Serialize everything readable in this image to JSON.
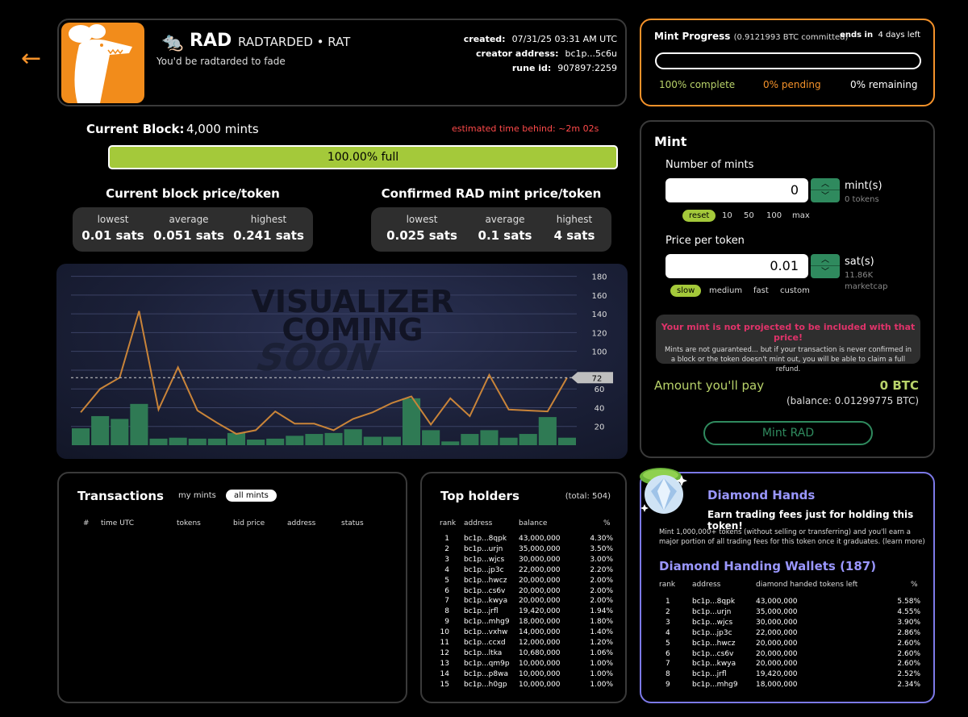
{
  "colors": {
    "accent": "#f5922a",
    "lime": "#a4c93a",
    "green": "#2f8a5e",
    "purple": "#9a97ff",
    "red": "#ff4a4a"
  },
  "icons": {
    "back": "left-arrow-icon",
    "logo": "rat-logo-icon",
    "gem": "diamond-gem-icon"
  },
  "header": {
    "back_arrow": "←",
    "emoji": "🐀",
    "ticker": "RAD",
    "rune_name": "RADTARDED • RAT",
    "tagline": "You'd be radtarded to fade",
    "created_label": "created:",
    "created_value": "07/31/25   03:31 AM UTC",
    "creator_label": "creator address:",
    "creator_value": "bc1p...5c6u",
    "rune_label": "rune id:",
    "rune_value": "907897:2259"
  },
  "block": {
    "label": "Current Block:",
    "value": "4,000 mints",
    "eta": "estimated time behind: ~2m 02s",
    "fill_text": "100.00% full",
    "fill_fraction": 1.0
  },
  "current_price": {
    "title": "Current block price/token",
    "lowest_label": "lowest",
    "lowest_value": "0.01 sats",
    "average_label": "average",
    "average_value": "0.051 sats",
    "highest_label": "highest",
    "highest_value": "0.241 sats"
  },
  "confirmed_price": {
    "title": "Confirmed RAD mint price/token",
    "lowest_label": "lowest",
    "lowest_value": "0.025 sats",
    "average_label": "average",
    "average_value": "0.1 sats",
    "highest_label": "highest",
    "highest_value": "4 sats"
  },
  "chart_data": {
    "type": "bar",
    "overlay_text": [
      "VISUALIZER",
      "COMING",
      "SOON"
    ],
    "y_ticks": [
      20,
      40,
      60,
      80,
      100,
      120,
      140,
      160,
      180
    ],
    "ylim": [
      0,
      185
    ],
    "marker_value": 72,
    "bars": [
      18,
      31,
      28,
      44,
      7,
      8,
      7,
      7,
      13,
      6,
      7,
      10,
      12,
      13,
      17,
      9,
      9,
      50,
      16,
      4,
      12,
      16,
      8,
      12,
      30,
      8
    ],
    "line": [
      35,
      60,
      72,
      143,
      38,
      83,
      37,
      24,
      12,
      16,
      36,
      23,
      23,
      16,
      28,
      35,
      45,
      52,
      22,
      50,
      31,
      75,
      38,
      37,
      36,
      72
    ],
    "colors": {
      "bar": "#2f7a54",
      "line": "#c98439",
      "marker": "#bfbfbf"
    }
  },
  "mint_progress": {
    "title": "Mint Progress",
    "btc_committed": "(0.9121993 BTC committed)",
    "ends_label": "ends in",
    "ends_value": "4 days left",
    "complete": "100% complete",
    "pending": "0% pending",
    "remaining": "0% remaining"
  },
  "mint": {
    "title": "Mint",
    "num_label": "Number of mints",
    "num_value": "0",
    "num_unit": "mint(s)",
    "num_sub": "0 tokens",
    "quick": [
      "reset",
      "10",
      "50",
      "100",
      "max"
    ],
    "price_label": "Price per token",
    "price_value": "0.01",
    "price_unit": "sat(s)",
    "price_sub1": "11.86K",
    "price_sub2": "marketcap",
    "speeds": [
      "slow",
      "medium",
      "fast",
      "custom"
    ],
    "warn_title": "Your mint is not projected to be included with that price!",
    "warn_body": "Mints are not guaranteed... but if your transaction is never confirmed in a block or the token doesn't mint out, you will be able to claim a full refund.",
    "pay_label": "Amount you'll pay",
    "pay_value": "0 BTC",
    "balance": "(balance: 0.01299775 BTC)",
    "button": "Mint RAD"
  },
  "transactions": {
    "title": "Transactions",
    "tab_my": "my mints",
    "tab_all": "all mints",
    "columns": [
      "#",
      "time UTC",
      "tokens",
      "bid price",
      "address",
      "status"
    ]
  },
  "holders": {
    "title": "Top holders",
    "total": "(total: 504)",
    "columns": [
      "rank",
      "address",
      "balance",
      "%"
    ],
    "rows": [
      [
        "1",
        "bc1p...8qpk",
        "43,000,000",
        "4.30%"
      ],
      [
        "2",
        "bc1p...urjn",
        "35,000,000",
        "3.50%"
      ],
      [
        "3",
        "bc1p...wjcs",
        "30,000,000",
        "3.00%"
      ],
      [
        "4",
        "bc1p...jp3c",
        "22,000,000",
        "2.20%"
      ],
      [
        "5",
        "bc1p...hwcz",
        "20,000,000",
        "2.00%"
      ],
      [
        "6",
        "bc1p...cs6v",
        "20,000,000",
        "2.00%"
      ],
      [
        "7",
        "bc1p...kwya",
        "20,000,000",
        "2.00%"
      ],
      [
        "8",
        "bc1p...jrfl",
        "19,420,000",
        "1.94%"
      ],
      [
        "9",
        "bc1p...mhg9",
        "18,000,000",
        "1.80%"
      ],
      [
        "10",
        "bc1p...vxhw",
        "14,000,000",
        "1.40%"
      ],
      [
        "11",
        "bc1p...ccxd",
        "12,000,000",
        "1.20%"
      ],
      [
        "12",
        "bc1p...ltka",
        "10,680,000",
        "1.06%"
      ],
      [
        "13",
        "bc1p...qm9p",
        "10,000,000",
        "1.00%"
      ],
      [
        "14",
        "bc1p...p8wa",
        "10,000,000",
        "1.00%"
      ],
      [
        "15",
        "bc1p...h0gp",
        "10,000,000",
        "1.00%"
      ]
    ]
  },
  "diamond": {
    "title": "Diamond Hands",
    "subtitle": "Earn trading fees just for holding this token!",
    "desc": "Mint 1,000,000+ tokens (without selling or transferring) and you'll earn a major portion of all trading fees for this token once it graduates. (learn more)",
    "wallets_title": "Diamond Handing Wallets (187)",
    "columns": [
      "rank",
      "address",
      "diamond handed tokens left",
      "%"
    ],
    "rows": [
      [
        "1",
        "bc1p...8qpk",
        "43,000,000",
        "5.58%"
      ],
      [
        "2",
        "bc1p...urjn",
        "35,000,000",
        "4.55%"
      ],
      [
        "3",
        "bc1p...wjcs",
        "30,000,000",
        "3.90%"
      ],
      [
        "4",
        "bc1p...jp3c",
        "22,000,000",
        "2.86%"
      ],
      [
        "5",
        "bc1p...hwcz",
        "20,000,000",
        "2.60%"
      ],
      [
        "6",
        "bc1p...cs6v",
        "20,000,000",
        "2.60%"
      ],
      [
        "7",
        "bc1p...kwya",
        "20,000,000",
        "2.60%"
      ],
      [
        "8",
        "bc1p...jrfl",
        "19,420,000",
        "2.52%"
      ],
      [
        "9",
        "bc1p...mhg9",
        "18,000,000",
        "2.34%"
      ]
    ]
  }
}
